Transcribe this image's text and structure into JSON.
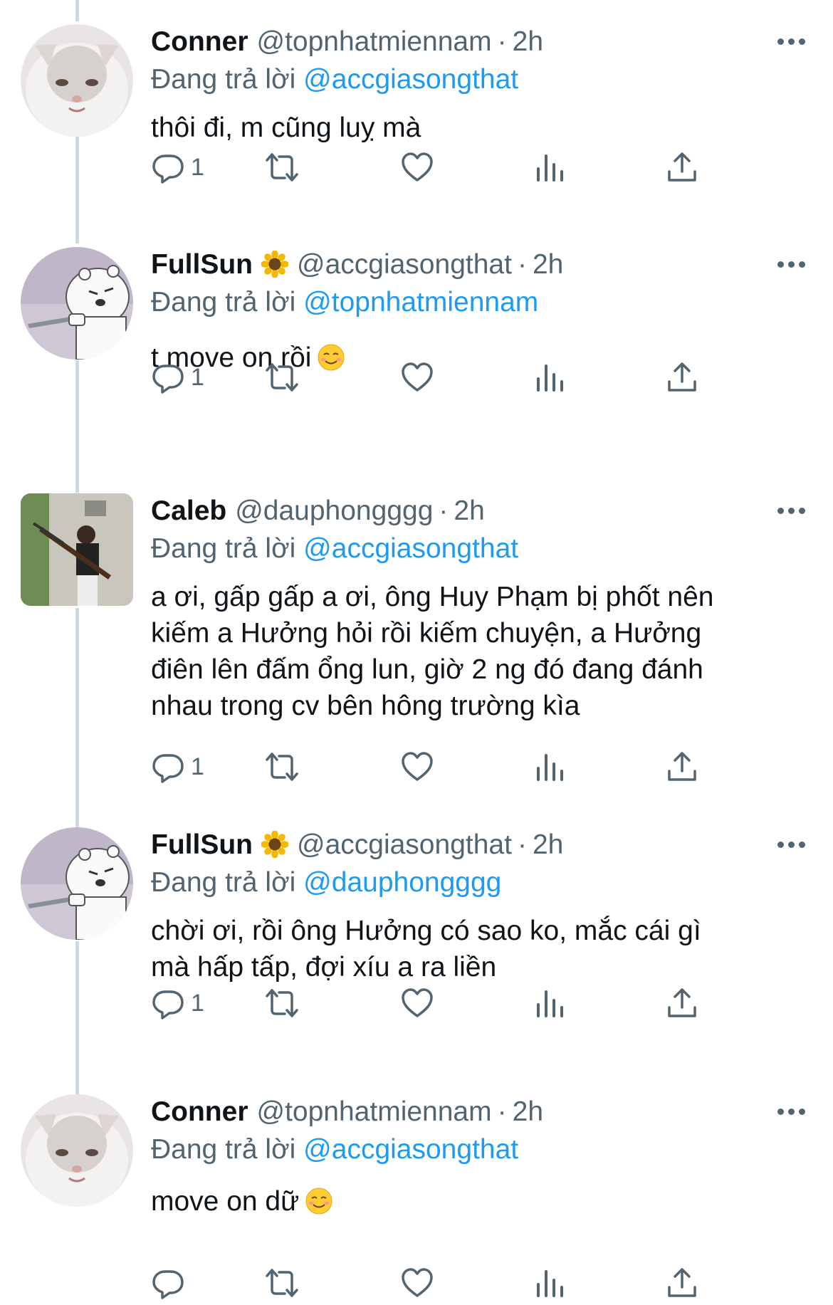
{
  "reply_prefix": "Đang trả lời",
  "colors": {
    "link": "#1d9bf0",
    "muted": "#536471",
    "text": "#0f1419",
    "thread": "#cfd9de"
  },
  "tweets": [
    {
      "name": "Conner",
      "handle": "@topnhatmiennam",
      "dot": "·",
      "time": "2h",
      "reply_to": "@accgiasongthat",
      "lines": [
        "thôi đi, m cũng luỵ mà"
      ],
      "reply_count": "1",
      "avatar": "white-cat-avatar"
    },
    {
      "name": "FullSun",
      "name_emoji": "sunflower-emoji",
      "handle": "@accgiasongthat",
      "dot": "·",
      "time": "2h",
      "reply_to": "@topnhatmiennam",
      "lines": [
        "t move on rồi"
      ],
      "text_emoji": "smiling-face-emoji",
      "reply_count": "1",
      "avatar": "bear-with-knife-avatar"
    },
    {
      "name": "Caleb",
      "handle": "@dauphongggg",
      "dot": "·",
      "time": "2h",
      "reply_to": "@accgiasongthat",
      "lines": [
        "a ơi, gấp gấp a ơi, ông Huy Phạm bị phốt nên",
        "kiếm a Hưởng hỏi rồi kiếm chuyện, a Hưởng",
        "điên lên đấm ổng lun, giờ 2 ng đó đang đánh",
        "nhau trong cv bên hông trường kìa"
      ],
      "reply_count": "1",
      "avatar": "boy-with-gun-photo-avatar"
    },
    {
      "name": "FullSun",
      "name_emoji": "sunflower-emoji",
      "handle": "@accgiasongthat",
      "dot": "·",
      "time": "2h",
      "reply_to": "@dauphongggg",
      "lines": [
        "chời ơi, rồi ông Hưởng có sao ko, mắc cái gì",
        "mà hấp tấp, đợi xíu a ra liền"
      ],
      "reply_count": "1",
      "avatar": "bear-with-knife-avatar"
    },
    {
      "name": "Conner",
      "handle": "@topnhatmiennam",
      "dot": "·",
      "time": "2h",
      "reply_to": "@accgiasongthat",
      "lines": [
        "move on dữ"
      ],
      "text_emoji": "smiling-face-emoji",
      "reply_count": "",
      "avatar": "white-cat-avatar"
    }
  ]
}
